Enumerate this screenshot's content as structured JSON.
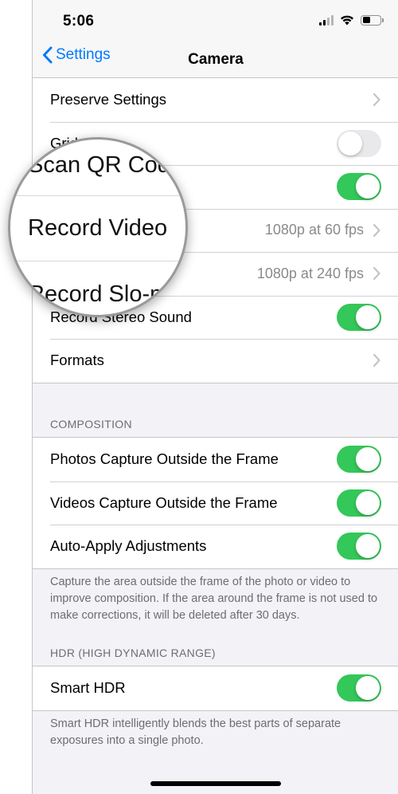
{
  "status_bar": {
    "time": "5:06"
  },
  "nav": {
    "back_label": "Settings",
    "title": "Camera"
  },
  "group1": {
    "preserve_settings": "Preserve Settings",
    "grid": "Grid",
    "scan_qr": "Scan QR Code",
    "record_video": "Record Video",
    "record_video_value": "1080p at 60 fps",
    "record_slomo": "Record Slo-mo",
    "record_slomo_value": "1080p at 240 fps",
    "record_stereo": "Record Stereo Sound",
    "formats": "Formats"
  },
  "composition": {
    "header": "COMPOSITION",
    "photos_capture": "Photos Capture Outside the Frame",
    "videos_capture": "Videos Capture Outside the Frame",
    "auto_apply": "Auto-Apply Adjustments",
    "footer": "Capture the area outside the frame of the photo or video to improve composition. If the area around the frame is not used to make corrections, it will be deleted after 30 days."
  },
  "hdr": {
    "header": "HDR (HIGH DYNAMIC RANGE)",
    "smart_hdr": "Smart HDR",
    "footer": "Smart HDR intelligently blends the best parts of separate exposures into a single photo."
  },
  "magnifier": {
    "scan_text": "Scan QR Cod",
    "record_video_text": "Record Video",
    "record_slomo_text": "Record Slo-m"
  },
  "toggles": {
    "grid": "off",
    "scan_qr": "on",
    "record_stereo": "on",
    "photos_capture": "on",
    "videos_capture": "on",
    "auto_apply": "on",
    "smart_hdr": "on"
  },
  "colors": {
    "accent": "#007aff",
    "toggle_on": "#34c759",
    "toggle_off": "#e9e9eb",
    "background": "#f2f2f7"
  },
  "icons": [
    "chevron-left-icon",
    "chevron-right-icon",
    "signal-icon",
    "wifi-icon",
    "battery-icon"
  ]
}
